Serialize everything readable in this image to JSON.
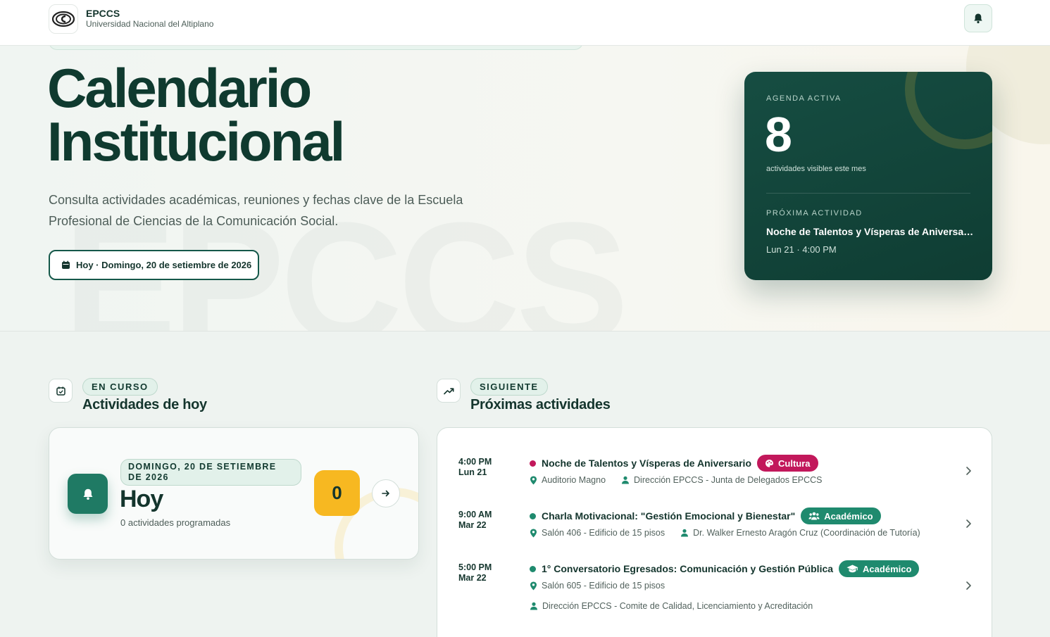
{
  "header": {
    "brand_title": "EPCCS",
    "brand_subtitle": "Universidad Nacional del Altiplano",
    "logo_icon": "epccs-logo-icon",
    "notifications_icon": "bell-icon"
  },
  "hero": {
    "title_line1": "Calendario",
    "title_line2": "Institucional",
    "description": "Consulta actividades académicas, reuniones y fechas clave de la Escuela Profesional de Ciencias de la Comunicación Social.",
    "today_chip": "Hoy · Domingo, 20 de setiembre de 2026",
    "watermark": "EPCCS"
  },
  "agenda": {
    "label": "AGENDA ACTIVA",
    "count": "8",
    "count_caption": "actividades visibles este mes",
    "next_label": "PRÓXIMA ACTIVIDAD",
    "next_title": "Noche de Talentos y Vísperas de Aniversario",
    "next_time": "Lun 21 · 4:00 PM"
  },
  "today_section": {
    "pill": "EN CURSO",
    "title": "Actividades de hoy",
    "date_badge": "DOMINGO, 20 DE SETIEMBRE DE 2026",
    "heading": "Hoy",
    "caption": "0 actividades programadas",
    "count": "0"
  },
  "upcoming_section": {
    "pill": "SIGUIENTE",
    "title": "Próximas actividades",
    "events": [
      {
        "time": "4:00 PM",
        "day": "Lun 21",
        "title": "Noche de Talentos y Vísperas de Aniversario",
        "tag": "Cultura",
        "tag_color": "#c2185b",
        "dot_color": "#c2185b",
        "location": "Auditorio Magno",
        "organizer": "Dirección EPCCS - Junta de Delegados EPCCS"
      },
      {
        "time": "9:00 AM",
        "day": "Mar 22",
        "title": "Charla Motivacional: \"Gestión Emocional y Bienestar\"",
        "tag": "Académico",
        "tag_color": "#1f8a6e",
        "dot_color": "#1f8a6e",
        "location": "Salón 406 - Edificio de 15 pisos",
        "organizer": "Dr. Walker Ernesto Aragón Cruz (Coordinación de Tutoría)"
      },
      {
        "time": "5:00 PM",
        "day": "Mar 22",
        "title": "1° Conversatorio Egresados: Comunicación y Gestión Pública",
        "tag": "Académico",
        "tag_color": "#1f8a6e",
        "dot_color": "#1f8a6e",
        "location": "Salón 605 - Edificio de 15 pisos",
        "organizer": "Dirección EPCCS - Comite de Calidad, Licenciamiento y Acreditación"
      }
    ]
  }
}
